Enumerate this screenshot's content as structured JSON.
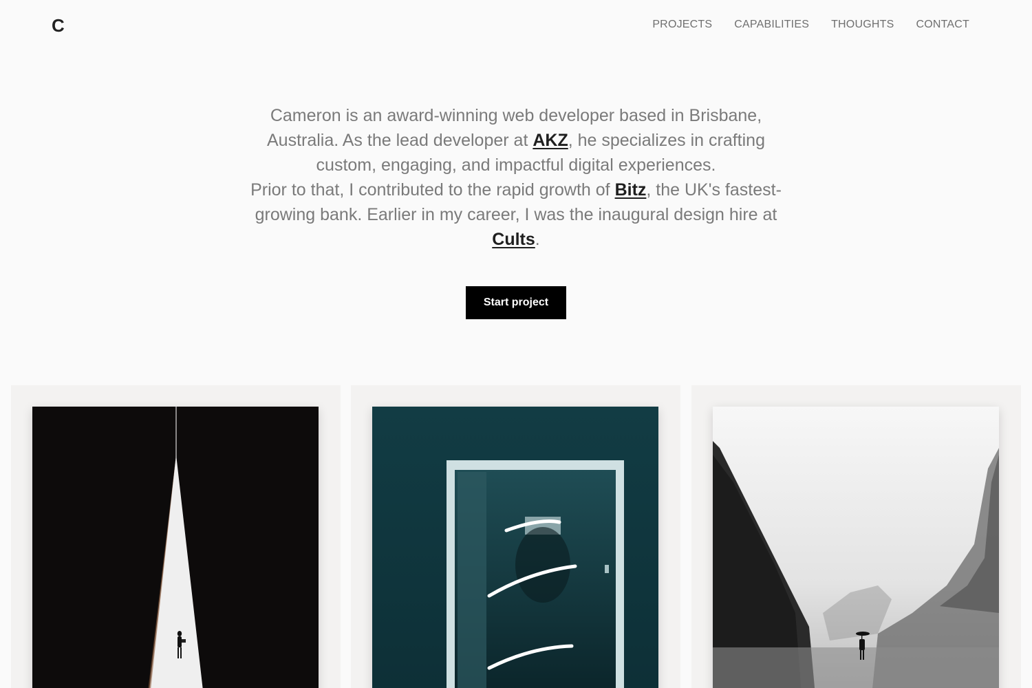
{
  "header": {
    "logo": "C",
    "nav": [
      "PROJECTS",
      "CAPABILITIES",
      "THOUGHTS",
      "CONTACT"
    ]
  },
  "intro": {
    "p1_a": "Cameron is an award-winning web developer based in Brisbane, Australia. As the lead developer at ",
    "p1_link": "AKZ",
    "p1_b": ", he specializes in crafting custom, engaging, and impactful digital experiences.",
    "p2_a": "Prior to that, I contributed to the rapid growth of ",
    "p2_link1": "Bitz",
    "p2_b": ", the UK's fastest-growing bank. Earlier in my career, I was the inaugural design hire at ",
    "p2_link2": "Cults",
    "p2_c": "."
  },
  "cta": {
    "label": "Start project"
  },
  "colors": {
    "background": "#fafafa",
    "text_muted": "#7a7a7a",
    "link": "#1f1f1f",
    "button_bg": "#000000",
    "card_bg": "#f3f2f1"
  }
}
